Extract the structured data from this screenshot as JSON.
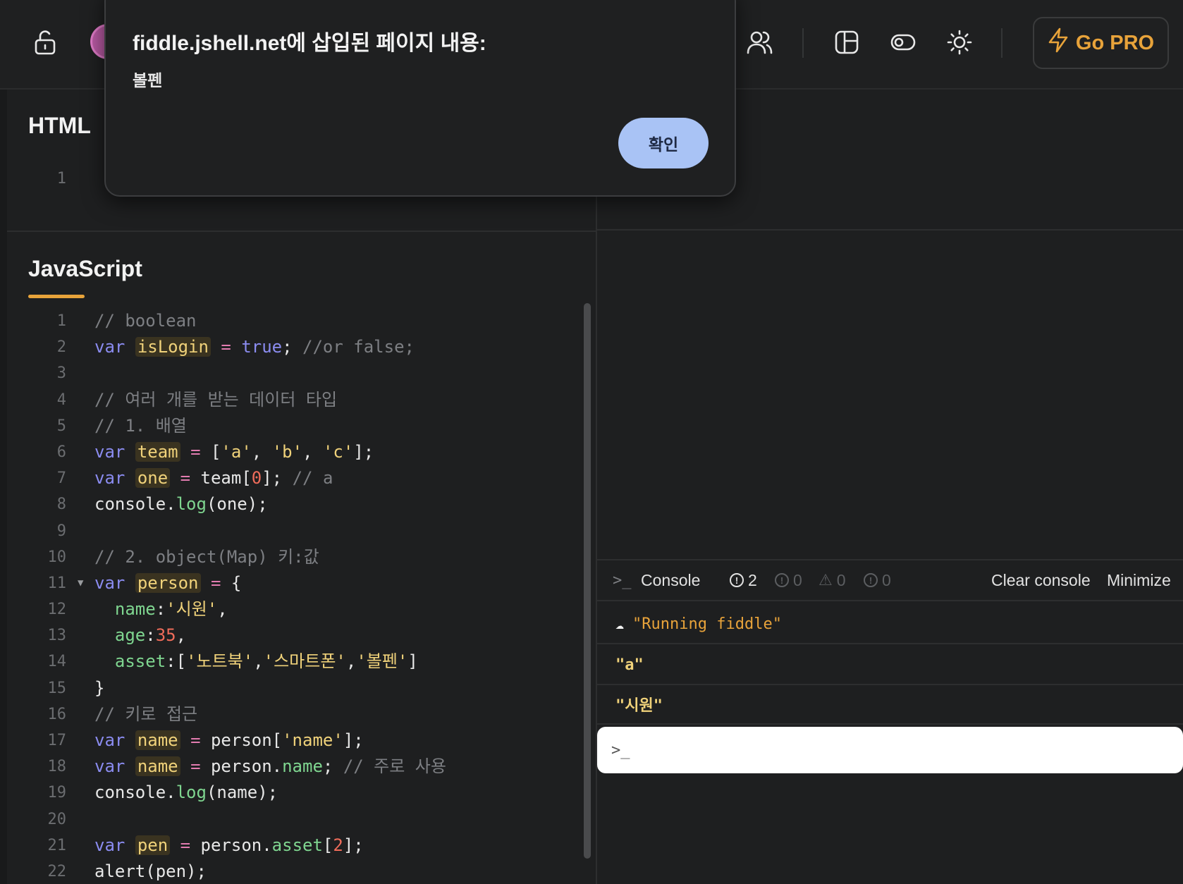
{
  "topbar": {
    "go_pro_label": "Go PRO",
    "icons": [
      "lock-icon",
      "users-icon",
      "layout-icon",
      "toggle-icon",
      "sun-icon",
      "bolt-icon"
    ]
  },
  "editor": {
    "html_title": "HTML",
    "html_lines": [
      "1"
    ],
    "js_title": "JavaScript"
  },
  "console": {
    "title": "Console",
    "counts": [
      "2",
      "0",
      "0",
      "0"
    ],
    "clear_label": "Clear console",
    "minimize_label": "Minimize",
    "logs": [
      "\"Running fiddle\"",
      "\"a\"",
      "\"시원\""
    ],
    "input_prompt": ">_"
  },
  "dialog": {
    "title": "fiddle.jshell.net에 삽입된 페이지 내용:",
    "message": "볼펜",
    "ok_label": "확인"
  },
  "colors": {
    "accent": "#e8a33a",
    "dialog_button": "#a9c3f5",
    "background": "#1e1f20"
  },
  "code_lines": [
    "// boolean",
    "var isLogin = true; //or false;",
    "",
    "// 여러 개를 받는 데이터 타입",
    "// 1. 배열",
    "var team = ['a', 'b', 'c'];",
    "var one = team[0]; // a",
    "console.log(one);",
    "",
    "// 2. object(Map) 키:값",
    "var person = {",
    "  name:'시원',",
    "  age:35,",
    "  asset:['노트북','스마트폰','볼펜']",
    "}",
    "// 키로 접근",
    "var name = person['name'];",
    "var name = person.name; // 주로 사용",
    "console.log(name);",
    "",
    "var pen = person.asset[2];",
    "alert(pen);"
  ]
}
